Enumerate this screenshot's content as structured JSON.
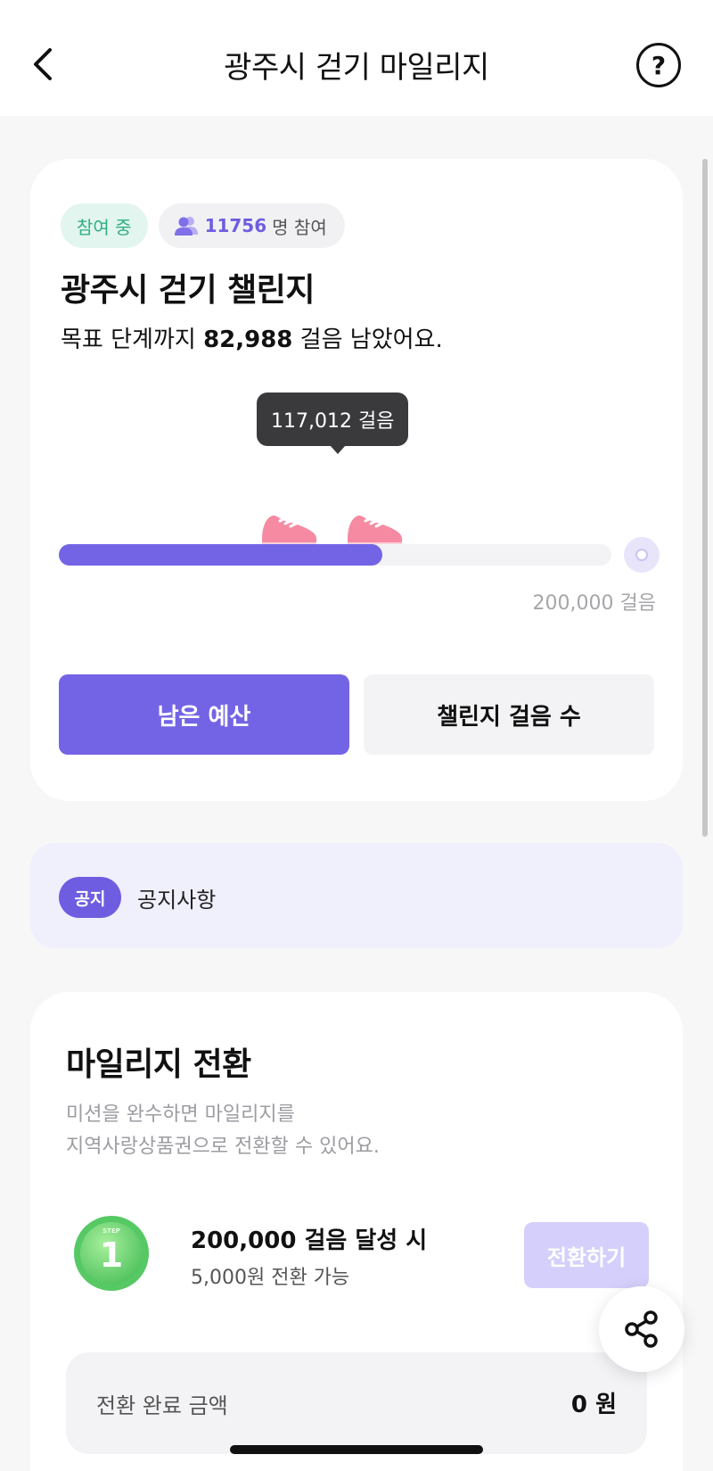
{
  "header": {
    "title": "광주시 걷기 마일리지",
    "help_symbol": "?",
    "back_icon": "chevron-left-icon",
    "help_icon": "question-circle-icon"
  },
  "challenge": {
    "status_badge": "참여 중",
    "participant_count": "11756",
    "participant_suffix": "명 참여",
    "title": "광주시 걷기 챌린지",
    "remaining_prefix": "목표 단계까지 ",
    "remaining_steps": "82,988",
    "remaining_suffix": " 걸음 남았어요.",
    "current_steps_label": "117,012 걸음",
    "goal_label": "200,000 걸음",
    "progress_fraction": 0.585,
    "buttons": {
      "budget": "남은 예산",
      "steps": "챌린지 걸음 수"
    }
  },
  "notice": {
    "badge": "공지",
    "text": "공지사항"
  },
  "mileage": {
    "title": "마일리지 전환",
    "desc_line1": "미션을 완수하면 마일리지를",
    "desc_line2": "지역사랑상품권으로 전환할 수 있어요.",
    "step": {
      "coin_label": "STEP",
      "number": "1",
      "title": "200,000 걸음 달성 시",
      "subtitle": "5,000원 전환 가능",
      "convert_button": "전환하기"
    },
    "total_label": "전환 완료 금액",
    "total_value": "0 원"
  },
  "colors": {
    "accent": "#7364e6",
    "status_green": "#2fae86",
    "convert_disabled": "#d4cffb"
  }
}
